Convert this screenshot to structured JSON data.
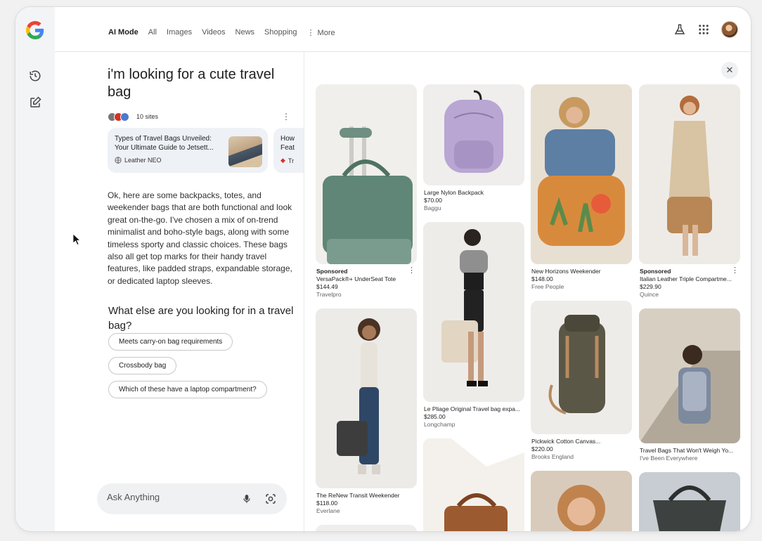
{
  "nav": {
    "tabs": [
      {
        "label": "AI Mode"
      },
      {
        "label": "All"
      },
      {
        "label": "Images"
      },
      {
        "label": "Videos"
      },
      {
        "label": "News"
      },
      {
        "label": "Shopping"
      },
      {
        "label": "More"
      }
    ]
  },
  "query": "i'm looking for a cute travel bag",
  "sources": {
    "count_label": "10 sites",
    "cards": [
      {
        "title": "Types of Travel Bags Unveiled: Your Ultimate Guide to Jetsett...",
        "source": "Leather NEO"
      },
      {
        "title": "How Feat",
        "source": "Tr"
      }
    ]
  },
  "answer": "Ok, here are some backpacks, totes, and weekender bags that are both functional and look great on-the-go. I've chosen a mix of on-trend minimalist and boho-style bags, along with some timeless sporty and classic choices. These bags also all get top marks for their handy travel features, like padded straps, expandable storage, or dedicated laptop sleeves.",
  "followup": {
    "question": "What else are you looking for in a travel bag?",
    "chips": [
      {
        "label": "Meets carry-on bag requirements"
      },
      {
        "label": "Crossbody bag"
      },
      {
        "label": "Which of these have a laptop compartment?"
      }
    ]
  },
  "ask": {
    "placeholder": "Ask Anything"
  },
  "products": {
    "col1": [
      {
        "sponsored": "Sponsored",
        "title": "VersaPack®+ UnderSeat Tote",
        "price": "$144.49",
        "store": "Travelpro"
      },
      {
        "title": "The ReNew Transit Weekender",
        "price": "$118.00",
        "store": "Everlane"
      }
    ],
    "col2": [
      {
        "title": "Large Nylon Backpack",
        "price": "$70.00",
        "store": "Baggu"
      },
      {
        "title": "Le Pliage Original Travel bag expa...",
        "price": "$285.00",
        "store": "Longchamp"
      }
    ],
    "col3": [
      {
        "title": "New Horizons Weekender",
        "price": "$148.00",
        "store": "Free People"
      },
      {
        "title": "Pickwick Cotton Canvas...",
        "price": "$220.00",
        "store": "Brooks England"
      }
    ],
    "col4": [
      {
        "sponsored": "Sponsored",
        "title": "Italian Leather Triple Compartme...",
        "price": "$229.90",
        "store": "Quince"
      },
      {
        "title": "Travel Bags That Won't Weigh Yo...",
        "store": "I've Been Everywhere"
      }
    ]
  },
  "colors": {
    "accent": "#1a73e8",
    "chip_border": "#c8c8c8",
    "card_bg": "#eef1f6"
  }
}
